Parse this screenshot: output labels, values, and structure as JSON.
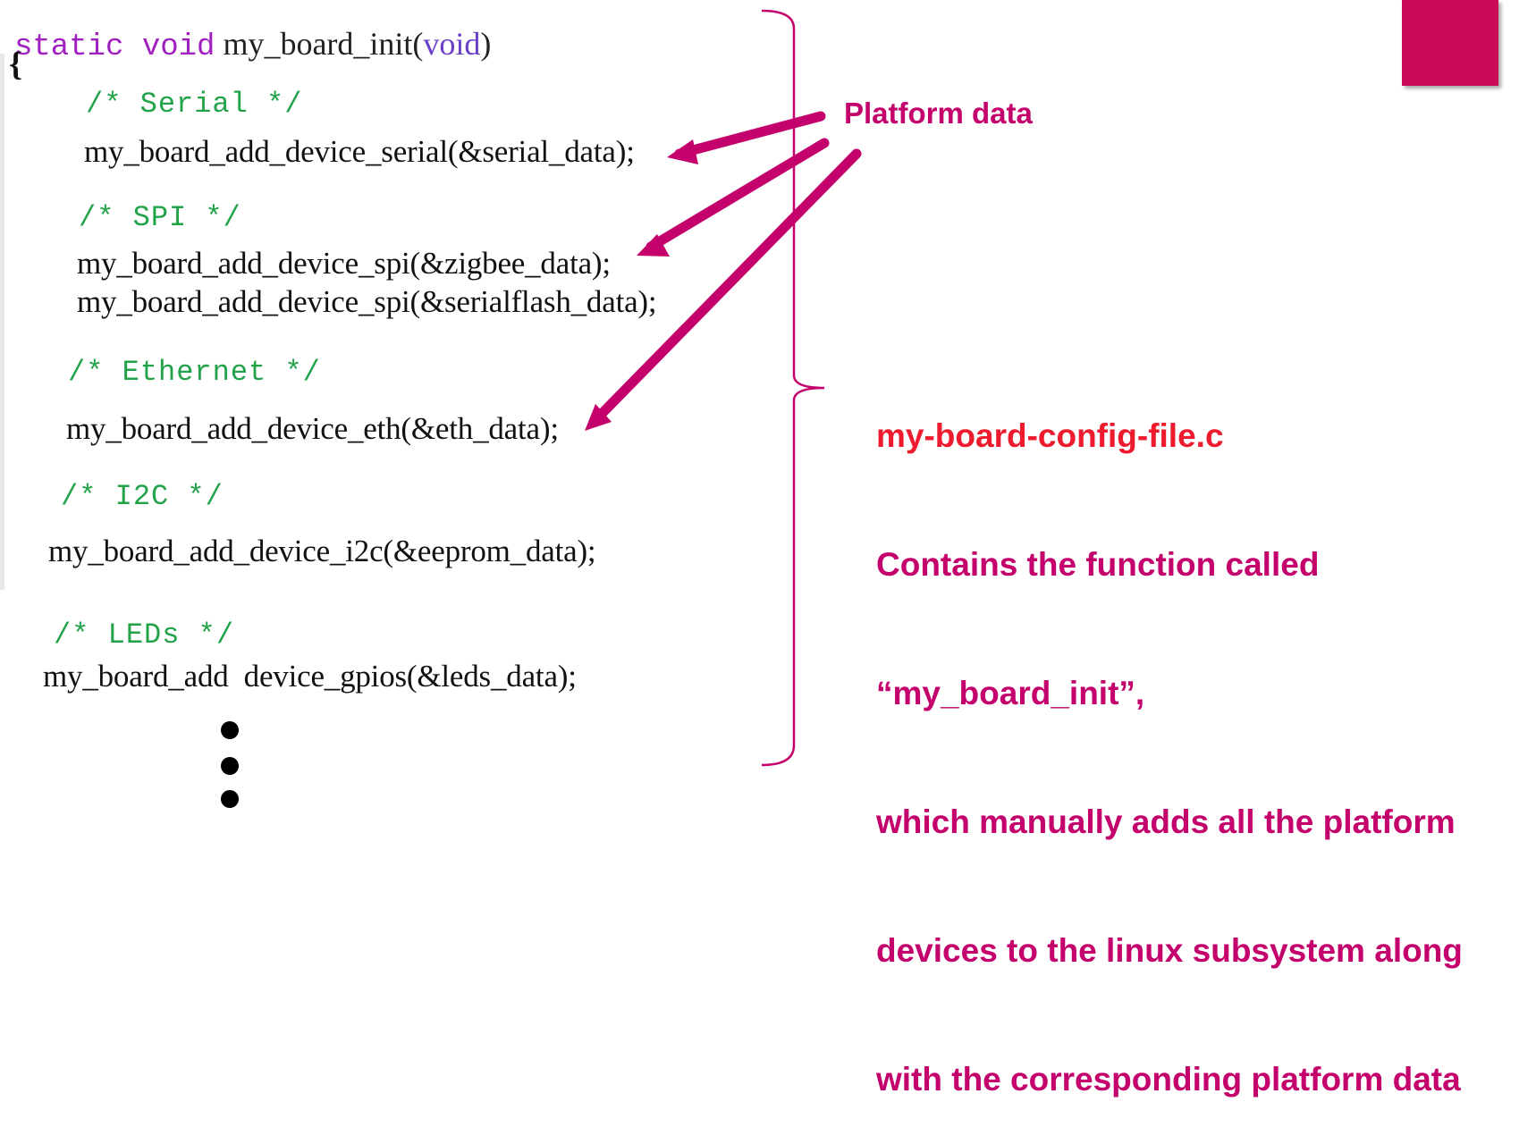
{
  "code": {
    "signature": {
      "keyword": "static void",
      "name": " my_board_init(",
      "param": "void",
      "close": ")"
    },
    "open_brace": "{",
    "sections": [
      {
        "comment": "/* Serial */",
        "calls": [
          "my_board_add_device_serial(&serial_data);"
        ]
      },
      {
        "comment": "/* SPI */",
        "calls": [
          "my_board_add_device_spi(&zigbee_data);",
          "my_board_add_device_spi(&serialflash_data);"
        ]
      },
      {
        "comment": "/* Ethernet */",
        "calls": [
          "my_board_add_device_eth(&eth_data);"
        ]
      },
      {
        "comment": "/* I2C */",
        "calls": [
          "my_board_add_device_i2c(&eeprom_data);"
        ]
      },
      {
        "comment": "/* LEDs */",
        "calls": [
          "my_board_add  device_gpios(&leds_data);"
        ]
      }
    ]
  },
  "annotation": {
    "label": "Platform data",
    "file_name": "my-board-config-file.c",
    "description_lines": [
      "Contains the function called",
      "“my_board_init”,",
      "which manually adds all the platform",
      "devices to the linux subsystem along",
      "with the corresponding platform data"
    ]
  },
  "colors": {
    "accent": "#c4006c",
    "file_name": "#ee1b2f",
    "comment": "#22a34a",
    "keyword": "#a020c0",
    "corner_block": "#cc0a5a"
  }
}
